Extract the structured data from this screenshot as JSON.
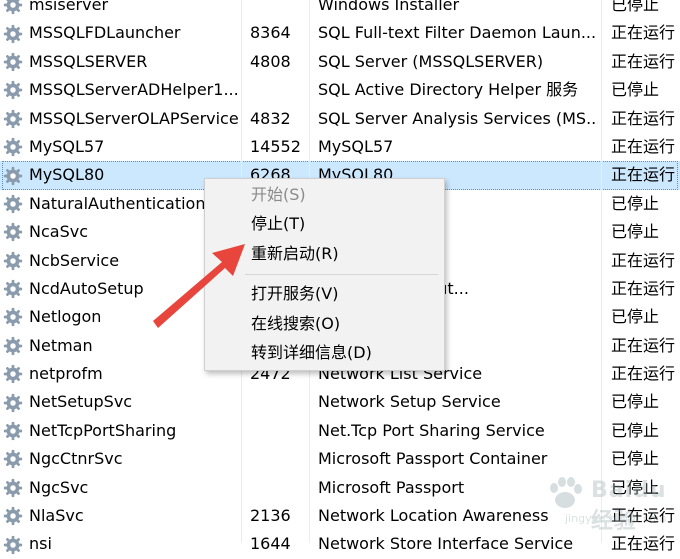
{
  "services": [
    {
      "name": "msiserver",
      "pid": "",
      "desc": "Windows Installer",
      "status": "已停止"
    },
    {
      "name": "MSSQLFDLauncher",
      "pid": "8364",
      "desc": "SQL Full-text Filter Daemon Laun...",
      "status": "正在运行"
    },
    {
      "name": "MSSQLSERVER",
      "pid": "4808",
      "desc": "SQL Server (MSSQLSERVER)",
      "status": "正在运行"
    },
    {
      "name": "MSSQLServerADHelper1...",
      "pid": "",
      "desc": "SQL Active Directory Helper 服务",
      "status": "已停止"
    },
    {
      "name": "MSSQLServerOLAPService",
      "pid": "4832",
      "desc": "SQL Server Analysis Services (MS...",
      "status": "正在运行"
    },
    {
      "name": "MySQL57",
      "pid": "14552",
      "desc": "MySQL57",
      "status": "正在运行"
    },
    {
      "name": "MySQL80",
      "pid": "6268",
      "desc": "MySQL80",
      "status": "正在运行"
    },
    {
      "name": "NaturalAuthentication",
      "pid": "",
      "desc": "",
      "status": "已停止"
    },
    {
      "name": "NcaSvc",
      "pid": "",
      "desc": "ctivity Assistant",
      "status": "已停止"
    },
    {
      "name": "NcbService",
      "pid": "",
      "desc": "ction Broker",
      "status": "正在运行"
    },
    {
      "name": "NcdAutoSetup",
      "pid": "",
      "desc": "cted Devices Aut...",
      "status": "正在运行"
    },
    {
      "name": "Netlogon",
      "pid": "",
      "desc": "",
      "status": "已停止"
    },
    {
      "name": "Netman",
      "pid": "",
      "desc": "ctions",
      "status": "正在运行"
    },
    {
      "name": "netprofm",
      "pid": "2472",
      "desc": "Network List Service",
      "status": "正在运行"
    },
    {
      "name": "NetSetupSvc",
      "pid": "",
      "desc": "Network Setup Service",
      "status": "已停止"
    },
    {
      "name": "NetTcpPortSharing",
      "pid": "",
      "desc": "Net.Tcp Port Sharing Service",
      "status": "已停止"
    },
    {
      "name": "NgcCtnrSvc",
      "pid": "",
      "desc": "Microsoft Passport Container",
      "status": "已停止"
    },
    {
      "name": "NgcSvc",
      "pid": "",
      "desc": "Microsoft Passport",
      "status": "已停止"
    },
    {
      "name": "NlaSvc",
      "pid": "2136",
      "desc": "Network Location Awareness",
      "status": "正在运行"
    },
    {
      "name": "nsi",
      "pid": "1644",
      "desc": "Network Store Interface Service",
      "status": "正在运行"
    }
  ],
  "selected_service": "MySQL80",
  "context_menu": {
    "start": "开始(S)",
    "stop": "停止(T)",
    "restart": "重新启动(R)",
    "open_services": "打开服务(V)",
    "search_online": "在线搜索(O)",
    "go_to_details": "转到详细信息(D)"
  },
  "watermark": {
    "brand": "Baidu 经验",
    "sub": "jingyan.baidu.com"
  },
  "colors": {
    "selection": "#cce8ff",
    "arrow": "#e8453c",
    "menu_bg": "#f2f2f2"
  }
}
